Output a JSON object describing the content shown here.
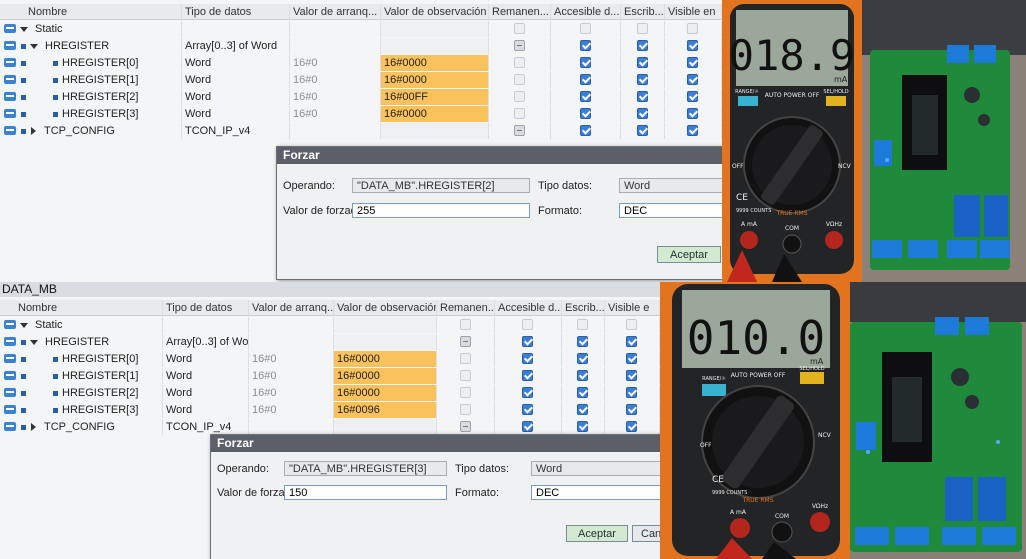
{
  "top_label": "DATA_MB",
  "headers": [
    "Nombre",
    "Tipo de datos",
    "Valor de arranq...",
    "Valor de observación",
    "Remanen...",
    "Accesible d...",
    "Escrib...",
    "Visible en"
  ],
  "headers_bottom": [
    "Nombre",
    "Tipo de datos",
    "Valor de arranq...",
    "Valor de observación",
    "Remanen...",
    "Accesible d...",
    "Escrib...",
    "Visible e"
  ],
  "top_table": {
    "rows": [
      {
        "name": "Static",
        "type": "",
        "start": "",
        "obs": ""
      },
      {
        "name": "HREGISTER",
        "type": "Array[0..3] of Word",
        "start": "",
        "obs": ""
      },
      {
        "name": "HREGISTER[0]",
        "type": "Word",
        "start": "16#0",
        "obs": "16#0000"
      },
      {
        "name": "HREGISTER[1]",
        "type": "Word",
        "start": "16#0",
        "obs": "16#0000"
      },
      {
        "name": "HREGISTER[2]",
        "type": "Word",
        "start": "16#0",
        "obs": "16#00FF"
      },
      {
        "name": "HREGISTER[3]",
        "type": "Word",
        "start": "16#0",
        "obs": "16#0000"
      },
      {
        "name": "TCP_CONFIG",
        "type": "TCON_IP_v4",
        "start": "",
        "obs": ""
      }
    ]
  },
  "bottom_table": {
    "rows": [
      {
        "name": "Static",
        "type": "",
        "start": "",
        "obs": ""
      },
      {
        "name": "HREGISTER",
        "type": "Array[0..3] of Word",
        "start": "",
        "obs": ""
      },
      {
        "name": "HREGISTER[0]",
        "type": "Word",
        "start": "16#0",
        "obs": "16#0000"
      },
      {
        "name": "HREGISTER[1]",
        "type": "Word",
        "start": "16#0",
        "obs": "16#0000"
      },
      {
        "name": "HREGISTER[2]",
        "type": "Word",
        "start": "16#0",
        "obs": "16#0000"
      },
      {
        "name": "HREGISTER[3]",
        "type": "Word",
        "start": "16#0",
        "obs": "16#0096"
      },
      {
        "name": "TCP_CONFIG",
        "type": "TCON_IP_v4",
        "start": "",
        "obs": ""
      }
    ]
  },
  "dialog_top": {
    "title": "Forzar",
    "operando_label": "Operando:",
    "operando_value": "\"DATA_MB\".HREGISTER[2]",
    "valor_label": "Valor de forzado",
    "valor_value": "255",
    "tipo_label": "Tipo datos:",
    "tipo_value": "Word",
    "formato_label": "Formato:",
    "formato_value": "DEC",
    "accept_label": "Aceptar"
  },
  "dialog_bottom": {
    "title": "Forzar",
    "operando_label": "Operando:",
    "operando_value": "\"DATA_MB\".HREGISTER[3]",
    "valor_label": "Valor de forzado",
    "valor_value": "150",
    "tipo_label": "Tipo datos:",
    "tipo_value": "Word",
    "formato_label": "Formato:",
    "formato_value": "DEC",
    "accept_label": "Aceptar",
    "cancel_label": "Can"
  },
  "meter_top": {
    "reading": "018.9",
    "unit": "mA",
    "labels": [
      "RANGE/☼",
      "AUTO POWER OFF",
      "SEL/HOLD",
      "OFF",
      "NCV",
      "TRUE RMS",
      "COM",
      "A mA",
      "VΩHz",
      "9999 COUNTS",
      "CE"
    ]
  },
  "meter_bottom": {
    "reading": "010.0",
    "unit": "mA",
    "labels": [
      "RANGE/☼",
      "AUTO POWER OFF",
      "SEL/HOLD",
      "OFF",
      "NCV",
      "TRUE RMS",
      "COM",
      "A mA",
      "VΩHz",
      "9999 COUNTS",
      "CE"
    ]
  },
  "colors": {
    "observed_highlight": "#f9c25c",
    "checkbox_on": "#3b7ed6",
    "meter_body": "#e2741f",
    "pcb_green": "#1f8a3b",
    "relay_blue": "#1b62c7"
  }
}
